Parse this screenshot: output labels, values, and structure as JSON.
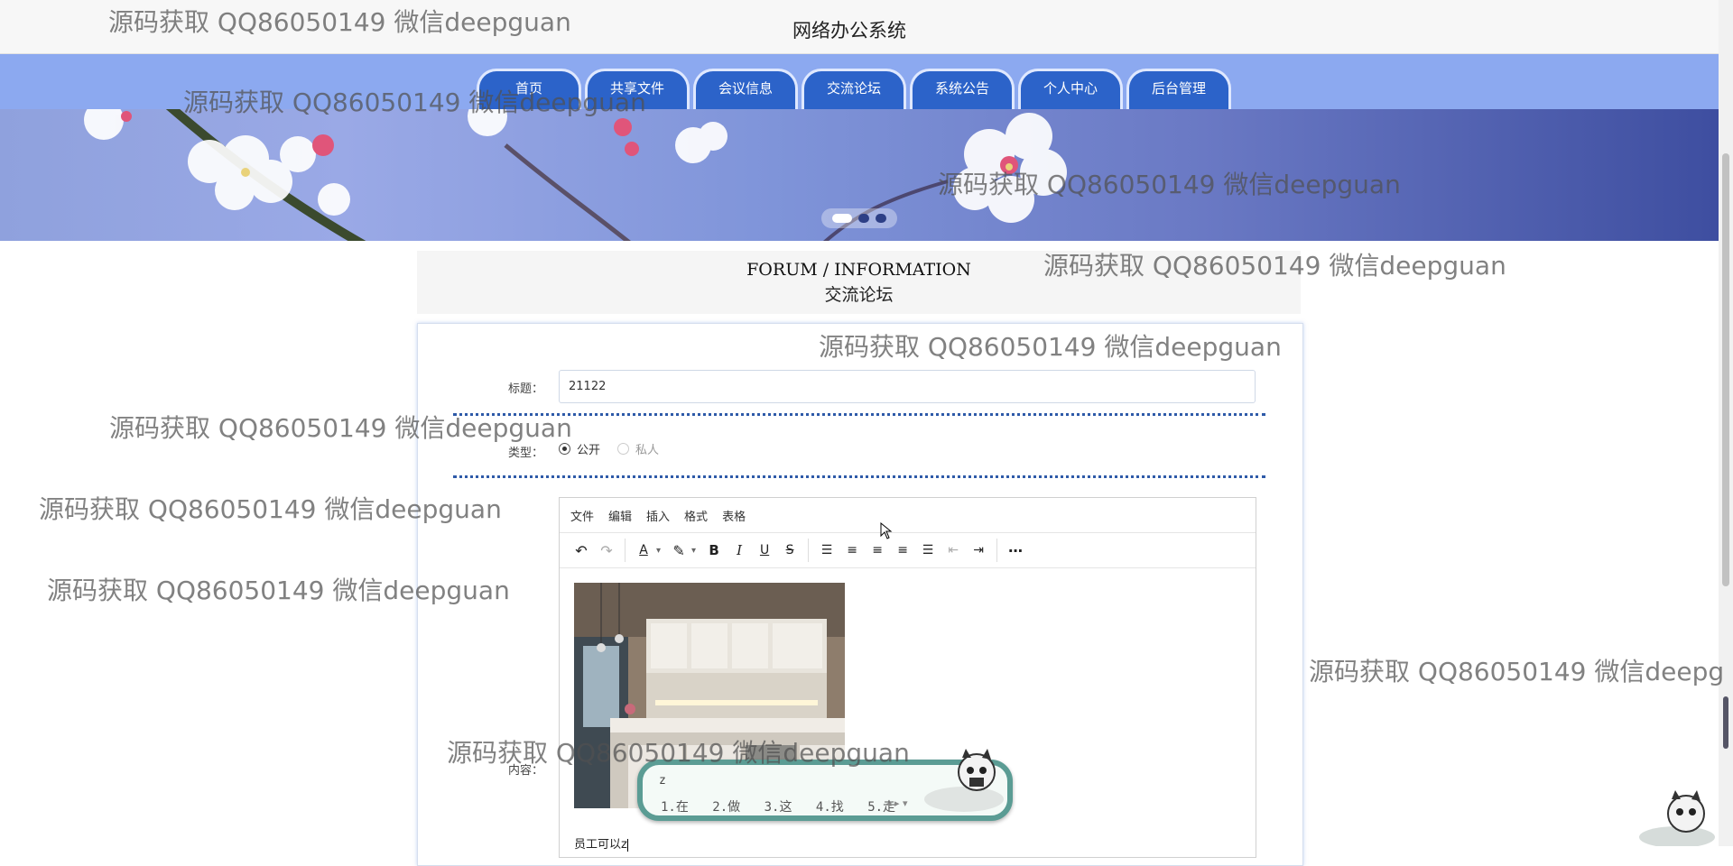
{
  "header": {
    "site_title": "网络办公系统"
  },
  "nav": {
    "items": [
      "首页",
      "共享文件",
      "会议信息",
      "交流论坛",
      "系统公告",
      "个人中心",
      "后台管理"
    ]
  },
  "banner": {
    "slide_count": 3,
    "active_slide": 1
  },
  "section": {
    "title_en": "FORUM / INFORMATION",
    "title_cn": "交流论坛"
  },
  "form": {
    "title_label": "标题：",
    "title_value": "21122",
    "type_label": "类型：",
    "type_options": [
      "公开",
      "私人"
    ],
    "type_selected": "公开",
    "content_label": "内容："
  },
  "editor": {
    "menus": [
      "文件",
      "编辑",
      "插入",
      "格式",
      "表格"
    ],
    "content_text": "员工可以z"
  },
  "ime": {
    "input": "z",
    "candidates": [
      "1.在",
      "2.做",
      "3.这",
      "4.找",
      "5.走"
    ]
  },
  "watermark": {
    "text": "源码获取 QQ86050149 微信deepguan",
    "text_cut": "源码获取 QQ86050149 微信deepg"
  },
  "colors": {
    "nav_bg": "#8ca9f0",
    "nav_tab": "#2c63c9",
    "divider": "#2e5aa8",
    "ime_border": "#5b9c94"
  }
}
